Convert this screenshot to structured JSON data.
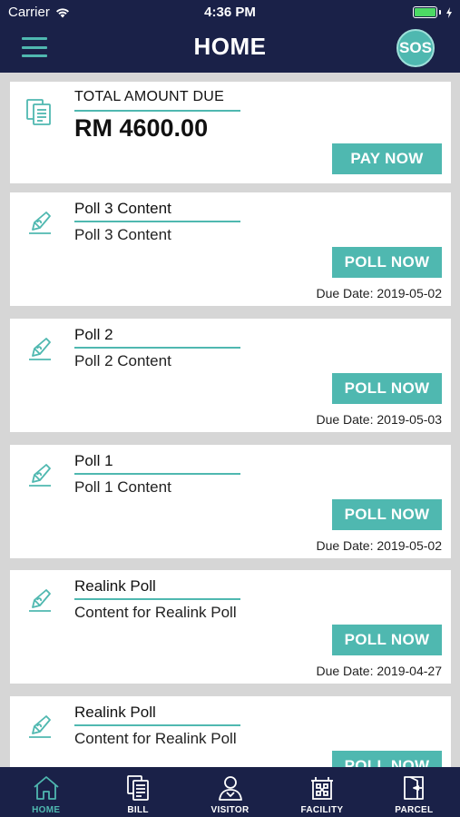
{
  "status_bar": {
    "carrier": "Carrier",
    "time": "4:36 PM",
    "battery_level": 1.0
  },
  "header": {
    "title": "HOME",
    "sos_label": "SOS"
  },
  "bill_card": {
    "title": "TOTAL AMOUNT DUE",
    "amount": "RM 4600.00",
    "button_label": "PAY NOW",
    "icon": "bill-icon"
  },
  "polls": [
    {
      "title": "Poll 3 Content",
      "content": "Poll 3 Content",
      "button_label": "POLL NOW",
      "due_date": "Due Date: 2019-05-02",
      "icon": "poll-pen-icon"
    },
    {
      "title": "Poll 2",
      "content": "Poll 2 Content",
      "button_label": "POLL NOW",
      "due_date": "Due Date: 2019-05-03",
      "icon": "poll-pen-icon"
    },
    {
      "title": "Poll 1",
      "content": "Poll 1 Content",
      "button_label": "POLL NOW",
      "due_date": "Due Date: 2019-05-02",
      "icon": "poll-pen-icon"
    },
    {
      "title": "Realink Poll",
      "content": "Content for Realink Poll",
      "button_label": "POLL NOW",
      "due_date": "Due Date: 2019-04-27",
      "icon": "poll-pen-icon"
    },
    {
      "title": "Realink Poll",
      "content": "Content for Realink Poll",
      "button_label": "POLL NOW",
      "due_date": "",
      "icon": "poll-pen-icon"
    }
  ],
  "tabs": [
    {
      "label": "HOME",
      "icon": "home-icon",
      "active": true
    },
    {
      "label": "BILL",
      "icon": "bill-icon",
      "active": false
    },
    {
      "label": "VISITOR",
      "icon": "visitor-icon",
      "active": false
    },
    {
      "label": "FACILITY",
      "icon": "facility-icon",
      "active": false
    },
    {
      "label": "PARCEL",
      "icon": "parcel-icon",
      "active": false
    }
  ],
  "colors": {
    "navy": "#1a2148",
    "teal": "#4fb8b0",
    "background": "#d6d6d6"
  }
}
